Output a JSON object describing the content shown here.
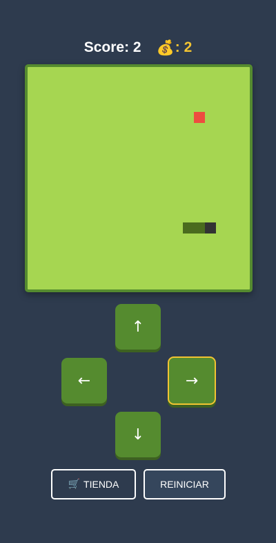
{
  "hud": {
    "score_text": "Score: 2",
    "coins_icon": "money-bag-icon",
    "coins_text": ": 2"
  },
  "board": {
    "grid_cells": 20,
    "food": {
      "col": 15,
      "row": 4
    },
    "snake": [
      {
        "col": 16,
        "row": 14
      },
      {
        "col": 15,
        "row": 14
      },
      {
        "col": 14,
        "row": 14
      }
    ],
    "colors": {
      "background": "#a6d651",
      "border": "#558b2f",
      "food": "#ee4c3f",
      "snake_body": "#4a6b1e",
      "snake_head": "#333333"
    }
  },
  "controls": {
    "up": "↑",
    "left": "←",
    "right": "→",
    "down": "↓",
    "active_direction": "right"
  },
  "buttons": {
    "shop_icon": "🛒",
    "shop_label": "TIENDA",
    "restart_label": "REINICIAR"
  }
}
